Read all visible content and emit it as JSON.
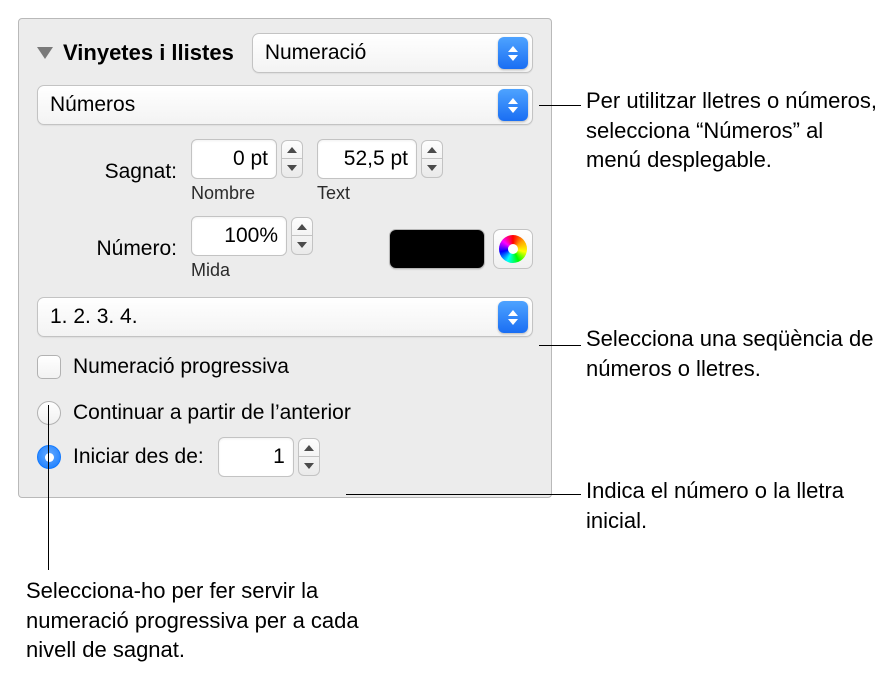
{
  "header": {
    "section_title": "Vinyetes i llistes",
    "list_style_popup": "Numeració"
  },
  "type_popup": "Números",
  "sagnat": {
    "label": "Sagnat:",
    "number_value": "0 pt",
    "number_sublabel": "Nombre",
    "text_value": "52,5 pt",
    "text_sublabel": "Text"
  },
  "numero": {
    "label": "Número:",
    "size_value": "100%",
    "size_sublabel": "Mida"
  },
  "sequence_popup": "1. 2. 3. 4.",
  "progressive": {
    "label": "Numeració progressiva"
  },
  "continue": {
    "label": "Continuar a partir de l’anterior"
  },
  "start": {
    "label": "Iniciar des de:",
    "value": "1"
  },
  "annotations": {
    "type": "Per utilitzar lletres o números, selecciona “Números” al menú desplegable.",
    "sequence": "Selecciona una seqüència de números o lletres.",
    "start": "Indica el número o la lletra inicial.",
    "progressive": "Selecciona-ho per fer servir la numeració progressiva per a cada nivell de sagnat."
  }
}
